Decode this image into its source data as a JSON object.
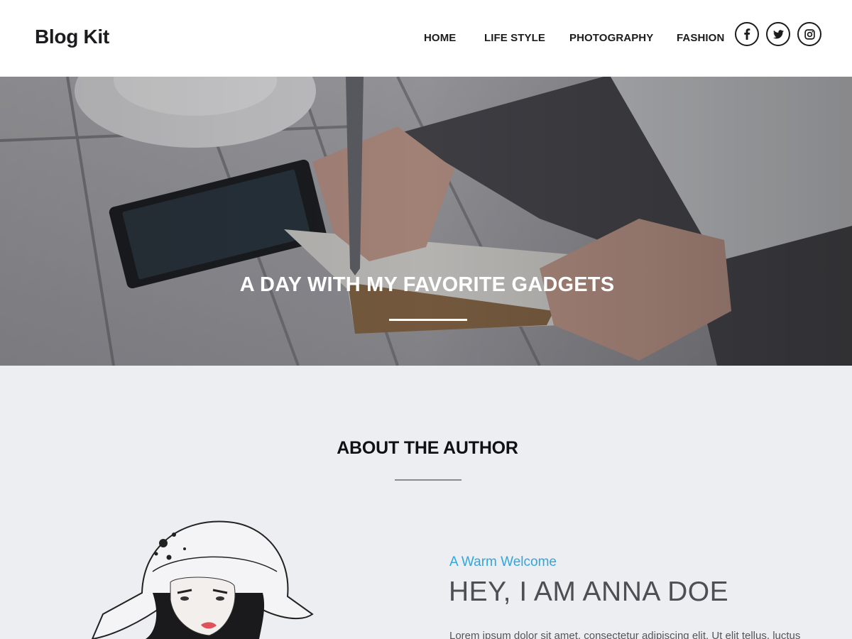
{
  "site": {
    "logo": "Blog Kit"
  },
  "nav": {
    "items": [
      {
        "label": "HOME"
      },
      {
        "label": "LIFE STYLE"
      },
      {
        "label": "PHOTOGRAPHY"
      },
      {
        "label": "FASHION"
      }
    ]
  },
  "social": {
    "icons": [
      "facebook-icon",
      "twitter-icon",
      "instagram-icon"
    ]
  },
  "hero": {
    "title": "A DAY WITH MY FAVORITE GADGETS"
  },
  "about": {
    "heading": "ABOUT THE AUTHOR",
    "kicker": "A Warm Welcome",
    "name": "HEY, I AM ANNA DOE",
    "intro": "Lorem ipsum dolor sit amet, consectetur adipiscing elit. Ut elit tellus, luctus"
  },
  "colors": {
    "accent": "#2ea7e0",
    "text_dark": "#1c1c1e",
    "section_bg": "#edeef2"
  }
}
